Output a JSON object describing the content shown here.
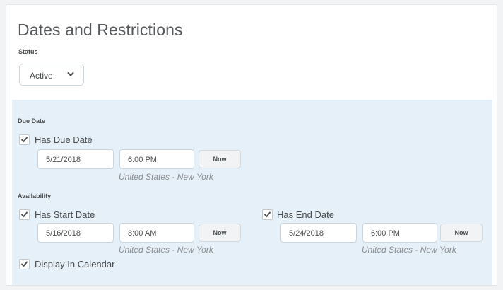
{
  "page_title": "Dates and Restrictions",
  "status": {
    "label": "Status",
    "selected": "Active"
  },
  "due_date": {
    "section_label": "Due Date",
    "checkbox_label": "Has Due Date",
    "checked": true,
    "date": "5/21/2018",
    "time": "6:00 PM",
    "now_label": "Now",
    "timezone": "United States - New York"
  },
  "availability": {
    "section_label": "Availability",
    "start": {
      "checkbox_label": "Has Start Date",
      "checked": true,
      "date": "5/16/2018",
      "time": "8:00 AM",
      "now_label": "Now",
      "timezone": "United States - New York"
    },
    "end": {
      "checkbox_label": "Has End Date",
      "checked": true,
      "date": "5/24/2018",
      "time": "6:00 PM",
      "now_label": "Now",
      "timezone": "United States - New York"
    },
    "display_calendar": {
      "checkbox_label": "Display In Calendar",
      "checked": true
    }
  },
  "colors": {
    "section_background": "#e6f0f8",
    "text": "#494c4e",
    "timezone_text": "#8a8d91"
  }
}
